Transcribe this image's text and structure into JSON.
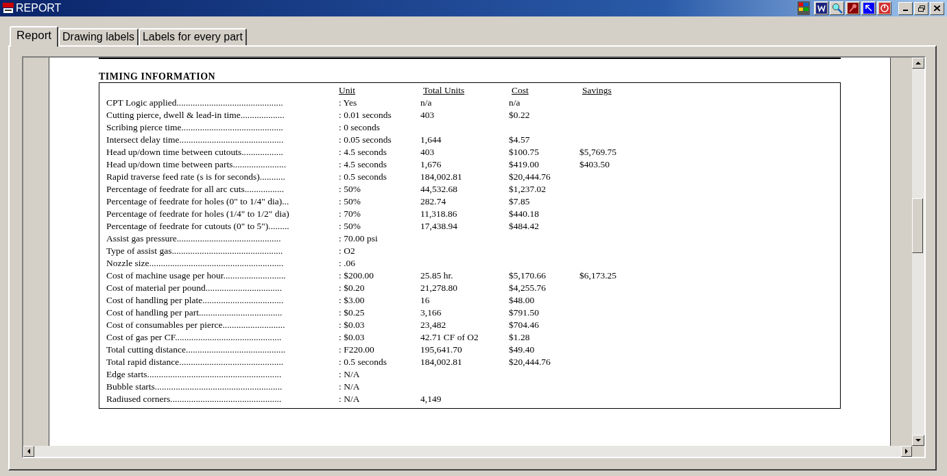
{
  "window": {
    "title": "REPORT"
  },
  "tabs": [
    {
      "label": "Report",
      "selected": true
    },
    {
      "label": "Drawing labels",
      "selected": false
    },
    {
      "label": "Labels for every part",
      "selected": false
    }
  ],
  "report": {
    "heading": "TIMING INFORMATION",
    "columns": [
      "Unit",
      "Total Units",
      "Cost",
      "Savings"
    ],
    "rows": [
      {
        "label": "CPT Logic applied..............................................",
        "unit": ": Yes",
        "total": "n/a",
        "cost": "n/a"
      },
      {
        "label": "Cutting pierce, dwell & lead-in time...................",
        "unit": ": 0.01 seconds",
        "total": "403",
        "cost": "$0.22"
      },
      {
        "label": "Scribing pierce time............................................",
        "unit": ": 0 seconds"
      },
      {
        "label": "Intersect delay time.............................................",
        "unit": ": 0.05 seconds",
        "total": "1,644",
        "cost": "$4.57"
      },
      {
        "label": "Head up/down time between cutouts..................",
        "unit": ": 4.5 seconds",
        "total": "403",
        "cost": "$100.75",
        "savings": "$5,769.75"
      },
      {
        "label": "Head up/down time between parts.......................",
        "unit": ": 4.5 seconds",
        "total": "1,676",
        "cost": "$419.00",
        "savings": "$403.50"
      },
      {
        "label": "Rapid traverse feed rate (s is for seconds)...........",
        "unit": ": 0.5 seconds",
        "total": "184,002.81",
        "cost": "$20,444.76"
      },
      {
        "label": "Percentage of feedrate for all arc cuts.................",
        "unit": ": 50%",
        "total": "44,532.68",
        "cost": "$1,237.02"
      },
      {
        "label": "Percentage of feedrate for holes (0\" to 1/4\" dia)...",
        "unit": ": 50%",
        "total": "282.74",
        "cost": "$7.85"
      },
      {
        "label": "Percentage of feedrate for holes (1/4\" to 1/2\" dia)",
        "unit": ": 70%",
        "total": "11,318.86",
        "cost": "$440.18"
      },
      {
        "label": "Percentage of feedrate for cutouts (0\" to 5\").........",
        "unit": ": 50%",
        "total": "17,438.94",
        "cost": "$484.42"
      },
      {
        "label": "Assist gas pressure.............................................",
        "unit": ": 70.00 psi"
      },
      {
        "label": "Type of assist gas................................................",
        "unit": ": O2"
      },
      {
        "label": "Nozzle size..........................................................",
        "unit": ": .06"
      },
      {
        "label": "Cost of machine usage per hour...........................",
        "unit": ": $200.00",
        "total": "25.85 hr.",
        "cost": "$5,170.66",
        "savings": "$6,173.25"
      },
      {
        "label": "Cost of material per pound.................................",
        "unit": ": $0.20",
        "total": "21,278.80",
        "cost": "$4,255.76"
      },
      {
        "label": "Cost of handling per plate...................................",
        "unit": ": $3.00",
        "total": "16",
        "cost": "$48.00"
      },
      {
        "label": "Cost of handling per part....................................",
        "unit": ": $0.25",
        "total": "3,166",
        "cost": "$791.50"
      },
      {
        "label": "Cost of consumables per pierce...........................",
        "unit": ": $0.03",
        "total": "23,482",
        "cost": "$704.46"
      },
      {
        "label": "Cost of gas per CF..............................................",
        "unit": ": $0.03",
        "total": "42.71 CF of O2",
        "cost": "$1.28"
      },
      {
        "label": "Total cutting distance...........................................",
        "unit": ": F220.00",
        "total": "195,641.70",
        "cost": "$49.40"
      },
      {
        "label": "Total rapid distance.............................................",
        "unit": ": 0.5 seconds",
        "total": "184,002.81",
        "cost": "$20,444.76"
      },
      {
        "label": "Edge starts..........................................................",
        "unit": ": N/A"
      },
      {
        "label": "Bubble starts.......................................................",
        "unit": ": N/A"
      },
      {
        "label": "Radiused corners................................................",
        "unit": ": N/A",
        "total": "4,149"
      }
    ]
  }
}
